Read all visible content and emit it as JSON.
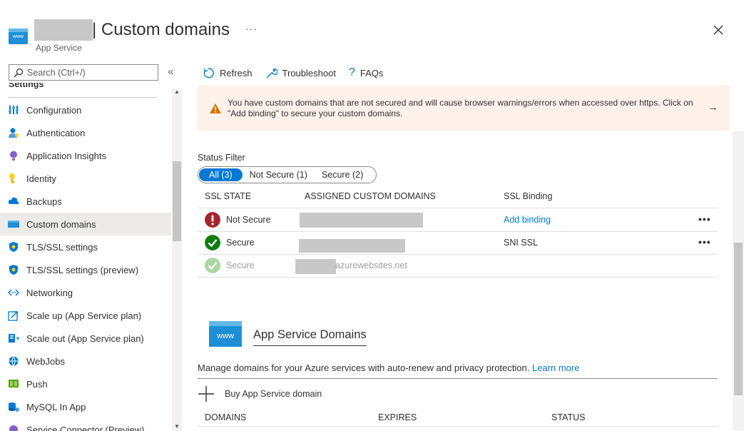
{
  "header": {
    "title": "| Custom domains",
    "more": "···",
    "subtitle": "App Service",
    "app_icon_text": "www",
    "close": "✕"
  },
  "sidebar": {
    "search_placeholder": "Search (Ctrl+/)",
    "collapse": "«",
    "section": "Settings",
    "items": [
      {
        "label": "Configuration",
        "icon": "configuration-icon"
      },
      {
        "label": "Authentication",
        "icon": "authentication-icon"
      },
      {
        "label": "Application Insights",
        "icon": "application-insights-icon"
      },
      {
        "label": "Identity",
        "icon": "identity-icon"
      },
      {
        "label": "Backups",
        "icon": "backups-icon"
      },
      {
        "label": "Custom domains",
        "icon": "custom-domains-icon",
        "active": true
      },
      {
        "label": "TLS/SSL settings",
        "icon": "shield-icon"
      },
      {
        "label": "TLS/SSL settings (preview)",
        "icon": "shield-icon"
      },
      {
        "label": "Networking",
        "icon": "networking-icon"
      },
      {
        "label": "Scale up (App Service plan)",
        "icon": "scale-up-icon"
      },
      {
        "label": "Scale out (App Service plan)",
        "icon": "scale-out-icon"
      },
      {
        "label": "WebJobs",
        "icon": "webjobs-icon"
      },
      {
        "label": "Push",
        "icon": "push-icon"
      },
      {
        "label": "MySQL In App",
        "icon": "mysql-icon"
      },
      {
        "label": "Service Connector (Preview)",
        "icon": "service-connector-icon"
      }
    ]
  },
  "toolbar": {
    "refresh": "Refresh",
    "troubleshoot": "Troubleshoot",
    "faqs": "FAQs"
  },
  "warning": {
    "text": "You have custom domains that are not secured and will cause browser warnings/errors when accessed over https. Click on \"Add binding\" to secure your custom domains.",
    "arrow": "→"
  },
  "status_filter": {
    "label": "Status Filter",
    "options": [
      "All (3)",
      "Not Secure (1)",
      "Secure (2)"
    ]
  },
  "table": {
    "headers": [
      "SSL STATE",
      "ASSIGNED CUSTOM DOMAINS",
      "SSL Binding"
    ],
    "rows": [
      {
        "state": "Not Secure",
        "domain": "",
        "binding": "Add binding",
        "more": "•••"
      },
      {
        "state": "Secure",
        "domain": "",
        "binding": "SNI SSL",
        "more": "•••"
      },
      {
        "state": "Secure",
        "domain": "azurewebsites.net",
        "binding": "",
        "more": ""
      }
    ]
  },
  "app_service_domains": {
    "icon_text": "www",
    "title": "App Service Domains",
    "description": "Manage domains for your Azure services with auto-renew and privacy protection.",
    "learn_more": "Learn more",
    "buy": "Buy App Service domain",
    "columns": [
      "DOMAINS",
      "EXPIRES",
      "STATUS"
    ]
  },
  "colors": {
    "accent": "#0078d4",
    "warning_bg": "#fdf1ea",
    "error": "#a4262c",
    "success": "#107c10"
  }
}
